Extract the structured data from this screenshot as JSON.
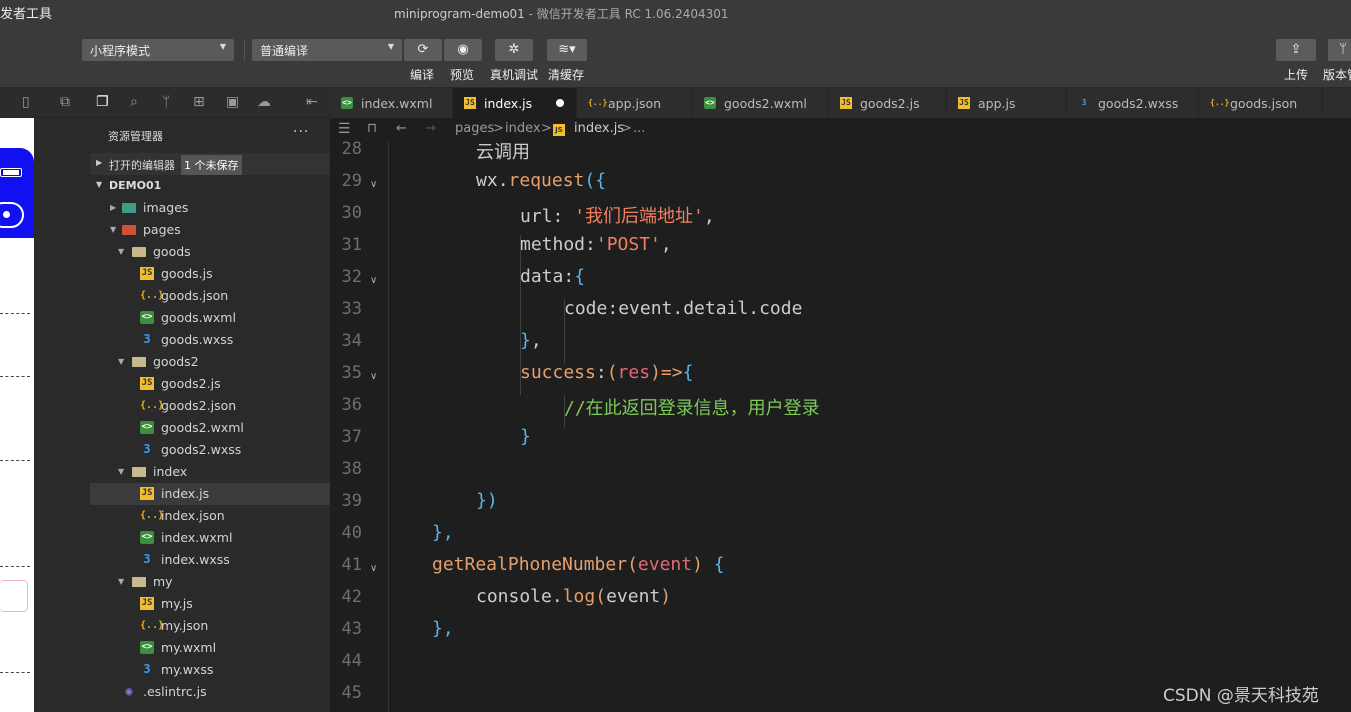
{
  "app": {
    "title": "发者工具",
    "window_title_main": "miniprogram-demo01",
    "window_title_sub": "- 微信开发者工具 RC 1.06.2404301"
  },
  "toolbar": {
    "mode_select": "小程序模式",
    "compile_select": "普通编译",
    "compile_label": "编译",
    "preview_label": "预览",
    "debug_label": "真机调试",
    "clear_cache_label": "清缓存",
    "upload_label": "上传",
    "version_label": "版本管"
  },
  "explorer": {
    "title": "资源管理器",
    "more": "···",
    "open_editors": "打开的编辑器",
    "unsaved_badge": "1 个未保存",
    "project": "DEMO01",
    "tree": [
      {
        "name": "images",
        "type": "folder-img",
        "depth": 0,
        "twisty": "▶"
      },
      {
        "name": "pages",
        "type": "folder-pg",
        "depth": 0,
        "twisty": "▼"
      },
      {
        "name": "goods",
        "type": "folder",
        "depth": 1,
        "twisty": "▼"
      },
      {
        "name": "goods.js",
        "type": "js",
        "depth": 2
      },
      {
        "name": "goods.json",
        "type": "json",
        "depth": 2
      },
      {
        "name": "goods.wxml",
        "type": "wxml",
        "depth": 2
      },
      {
        "name": "goods.wxss",
        "type": "wxss",
        "depth": 2
      },
      {
        "name": "goods2",
        "type": "folder",
        "depth": 1,
        "twisty": "▼"
      },
      {
        "name": "goods2.js",
        "type": "js",
        "depth": 2
      },
      {
        "name": "goods2.json",
        "type": "json",
        "depth": 2
      },
      {
        "name": "goods2.wxml",
        "type": "wxml",
        "depth": 2
      },
      {
        "name": "goods2.wxss",
        "type": "wxss",
        "depth": 2
      },
      {
        "name": "index",
        "type": "folder",
        "depth": 1,
        "twisty": "▼"
      },
      {
        "name": "index.js",
        "type": "js",
        "depth": 2,
        "selected": true
      },
      {
        "name": "index.json",
        "type": "json",
        "depth": 2
      },
      {
        "name": "index.wxml",
        "type": "wxml",
        "depth": 2
      },
      {
        "name": "index.wxss",
        "type": "wxss",
        "depth": 2
      },
      {
        "name": "my",
        "type": "folder",
        "depth": 1,
        "twisty": "▼"
      },
      {
        "name": "my.js",
        "type": "js",
        "depth": 2
      },
      {
        "name": "my.json",
        "type": "json",
        "depth": 2
      },
      {
        "name": "my.wxml",
        "type": "wxml",
        "depth": 2
      },
      {
        "name": "my.wxss",
        "type": "wxss",
        "depth": 2
      },
      {
        "name": ".eslintrc.js",
        "type": "eslint",
        "depth": 0
      }
    ]
  },
  "tabs": [
    {
      "name": "index.wxml",
      "type": "wxml"
    },
    {
      "name": "index.js",
      "type": "js",
      "active": true,
      "unsaved": true
    },
    {
      "name": "app.json",
      "type": "json"
    },
    {
      "name": "goods2.wxml",
      "type": "wxml"
    },
    {
      "name": "goods2.js",
      "type": "js"
    },
    {
      "name": "app.js",
      "type": "js"
    },
    {
      "name": "goods2.wxss",
      "type": "wxss"
    },
    {
      "name": "goods.json",
      "type": "json"
    }
  ],
  "breadcrumb": {
    "p1": "pages",
    "sep1": ">",
    "p2": "index",
    "sep2": ">",
    "file": "index.js",
    "sep3": ">",
    "rest": "..."
  },
  "code": {
    "line_numbers": [
      "28",
      "29",
      "30",
      "31",
      "32",
      "33",
      "34",
      "35",
      "36",
      "37",
      "38",
      "39",
      "40",
      "41",
      "42",
      "43",
      "44",
      "45"
    ],
    "folds": {
      "29": true,
      "32": true,
      "35": true,
      "41": true
    },
    "lines": [
      [
        [
          "云调用",
          "#cccccc"
        ]
      ],
      [
        [
          "wx",
          "#cccccc"
        ],
        [
          ".",
          "#cccccc"
        ],
        [
          "request",
          "#e5a06e"
        ],
        [
          "({",
          "#5bb5e8"
        ]
      ],
      [
        [
          "url",
          "#cccccc"
        ],
        [
          ": ",
          "#cccccc"
        ],
        [
          "'我们后端地址'",
          "#f08060"
        ],
        [
          ",",
          "#cccccc"
        ]
      ],
      [
        [
          "method",
          "#cccccc"
        ],
        [
          ":",
          "#cccccc"
        ],
        [
          "'POST'",
          "#f08060"
        ],
        [
          ",",
          "#cccccc"
        ]
      ],
      [
        [
          "data",
          "#cccccc"
        ],
        [
          ":",
          "#cccccc"
        ],
        [
          "{",
          "#5bb5e8"
        ]
      ],
      [
        [
          "code",
          "#cccccc"
        ],
        [
          ":event.detail.code",
          "#cccccc"
        ]
      ],
      [
        [
          "}",
          "#5bb5e8"
        ],
        [
          ",",
          "#cccccc"
        ]
      ],
      [
        [
          "success",
          "#e5a06e"
        ],
        [
          ":",
          "#cccccc"
        ],
        [
          "(",
          "#e5a06e"
        ],
        [
          "res",
          "#e06c75"
        ],
        [
          ")",
          "#e5a06e"
        ],
        [
          "=>",
          "#e5a06e"
        ],
        [
          "{",
          "#5bb5e8"
        ]
      ],
      [
        [
          "//在此返回登录信息，用户登录",
          "#7ec95a"
        ]
      ],
      [
        [
          "}",
          "#5bb5e8"
        ]
      ],
      [
        [
          "",
          ""
        ]
      ],
      [
        [
          "})",
          "#5bb5e8"
        ]
      ],
      [
        [
          "},",
          "#5bb5e8"
        ]
      ],
      [
        [
          "getRealPhoneNumber",
          "#e5a06e"
        ],
        [
          "(",
          "#e5a06e"
        ],
        [
          "event",
          "#e06c75"
        ],
        [
          ")",
          "#e5a06e"
        ],
        [
          " {",
          "#5bb5e8"
        ]
      ],
      [
        [
          "console",
          "#cccccc"
        ],
        [
          ".",
          "#cccccc"
        ],
        [
          "log",
          "#e5a06e"
        ],
        [
          "(",
          "#e5a06e"
        ],
        [
          "event",
          "#cccccc"
        ],
        [
          ")",
          "#e5a06e"
        ]
      ],
      [
        [
          "},",
          "#5bb5e8"
        ]
      ],
      [
        [
          "",
          ""
        ]
      ],
      [
        [
          "",
          ""
        ]
      ]
    ],
    "indents": [
      2,
      2,
      3,
      3,
      3,
      4,
      3,
      3,
      4,
      3,
      2,
      2,
      1,
      1,
      2,
      1,
      0,
      0
    ]
  },
  "watermark": "CSDN @景天科技苑"
}
